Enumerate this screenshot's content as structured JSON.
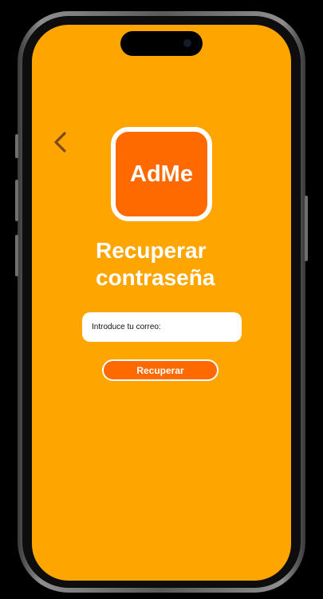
{
  "colors": {
    "screen_background": "#FFA500",
    "accent": "#FF6A00",
    "back_arrow": "#7A4A1E",
    "text_light": "#FFFFFF"
  },
  "header": {
    "back_icon": "chevron-left-icon"
  },
  "logo": {
    "text": "AdMe"
  },
  "title": {
    "line1": "Recuperar",
    "line2": "contraseña"
  },
  "form": {
    "email_placeholder": "Introduce tu correo:",
    "email_value": "",
    "submit_label": "Recuperar"
  }
}
